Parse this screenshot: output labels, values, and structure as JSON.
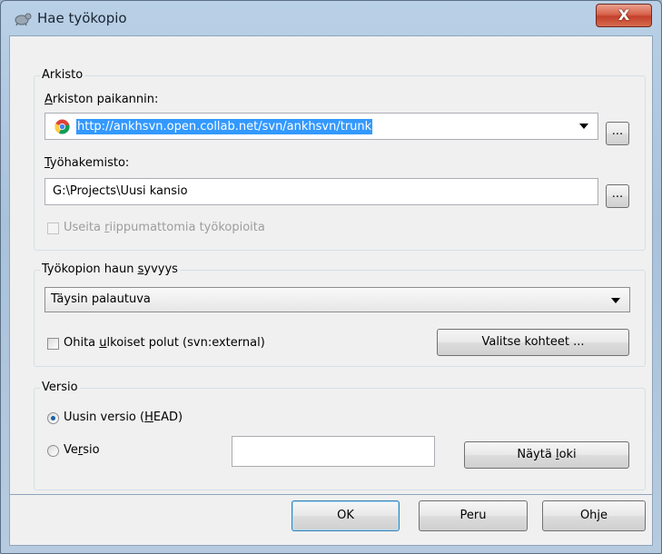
{
  "window": {
    "title": "Hae työkopio",
    "title_icon": "tortoise-svn-icon",
    "close_label": "X"
  },
  "repository_group": {
    "title": "Arkisto",
    "url_label": "Arkiston paikannin:",
    "url_value": "http://ankhsvn.open.collab.net/svn/ankhsvn/trunk",
    "url_icon": "chrome-icon",
    "browse_label": "...",
    "dir_label": "Työhakemisto:",
    "dir_value": "G:\\Projects\\Uusi kansio",
    "multiple_label": "Useita riippumattomia työkopioita",
    "multiple_checked": false,
    "multiple_enabled": false
  },
  "depth_group": {
    "title": "Työkopion haun syvyys",
    "depth_value": "Täysin palautuva",
    "externals_label": "Ohita ulkoiset polut (svn:external)",
    "externals_checked": false,
    "choose_items_label": "Valitse kohteet ..."
  },
  "revision_group": {
    "title": "Versio",
    "head_label": "Uusin versio (HEAD)",
    "revision_label": "Versio",
    "revision_value": "",
    "selected": "head",
    "show_log_label": "Näytä loki"
  },
  "footer": {
    "ok_label": "OK",
    "cancel_label": "Peru",
    "help_label": "Ohje"
  }
}
